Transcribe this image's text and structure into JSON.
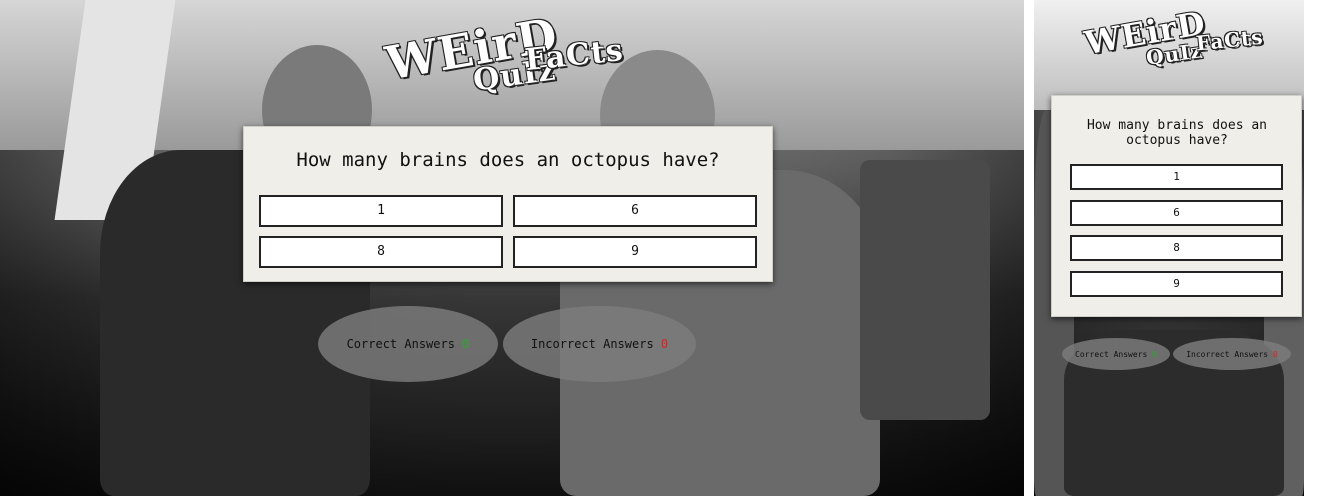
{
  "logo": {
    "line1": "WEirD",
    "line2": "QuIz",
    "line3": "FaCts"
  },
  "quiz": {
    "question": "How many brains does an octopus have?",
    "answers": [
      "1",
      "6",
      "8",
      "9"
    ]
  },
  "score": {
    "correct_label": "Correct Answers",
    "correct_value": "0",
    "incorrect_label": "Incorrect Answers",
    "incorrect_value": "0"
  },
  "colors": {
    "correct": "#2aa82a",
    "incorrect": "#e02020"
  }
}
